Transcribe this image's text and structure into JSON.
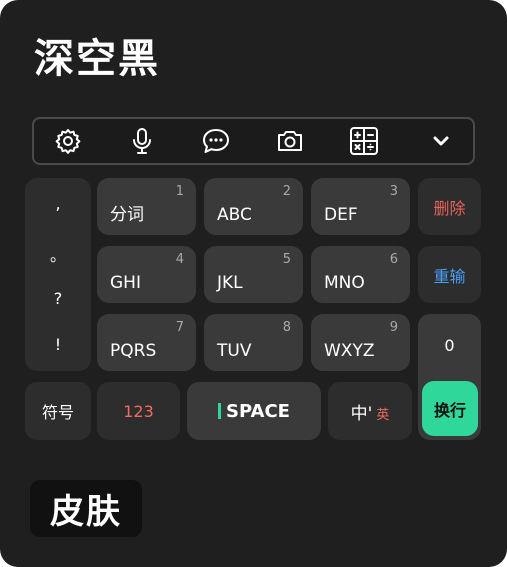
{
  "title": "深空黑",
  "toolbar": {
    "icons": [
      "gear-icon",
      "microphone-icon",
      "chat-bubble-icon",
      "camera-icon",
      "calculator-icon",
      "chevron-down-icon"
    ]
  },
  "punctuation": [
    ",",
    "。",
    "?",
    "!"
  ],
  "keys": [
    {
      "num": "1",
      "label": "分词"
    },
    {
      "num": "2",
      "label": "ABC"
    },
    {
      "num": "3",
      "label": "DEF"
    },
    {
      "num": "4",
      "label": "GHI"
    },
    {
      "num": "5",
      "label": "JKL"
    },
    {
      "num": "6",
      "label": "MNO"
    },
    {
      "num": "7",
      "label": "PQRS"
    },
    {
      "num": "8",
      "label": "TUV"
    },
    {
      "num": "9",
      "label": "WXYZ"
    }
  ],
  "right_column": {
    "delete_label": "删除",
    "retype_label": "重输",
    "zero_label": "0",
    "enter_label": "换行"
  },
  "bottom_row": {
    "symbol_label": "符号",
    "numeric_label": "123",
    "space_label": "SPACE",
    "lang_main": "中'",
    "lang_alt": "英"
  },
  "skin_label": "皮肤",
  "colors": {
    "background": "#1f1f1f",
    "key": "#3a3a3a",
    "delete": "#e8625b",
    "retype": "#4a9ff5",
    "numeric": "#ee6b62",
    "enter": "#2fd89a",
    "space_cursor": "#2fd89a"
  }
}
